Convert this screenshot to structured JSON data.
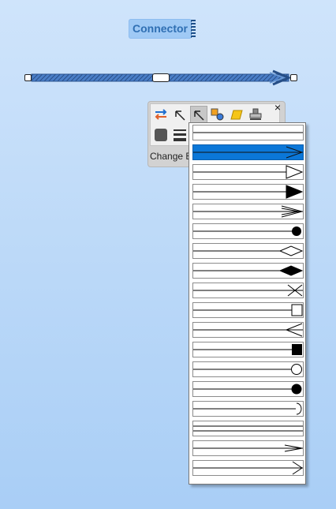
{
  "connector": {
    "label": "Connector"
  },
  "toolbar": {
    "caption": "Change End",
    "buttons": [
      {
        "icon": "swap-direction-icon"
      },
      {
        "icon": "pointer-arrow-icon"
      },
      {
        "icon": "end-style-arrow-icon",
        "active": true
      },
      {
        "icon": "shapes-icon"
      },
      {
        "icon": "fill-color-icon"
      },
      {
        "icon": "stamp-icon"
      },
      {
        "icon": "line-color-icon"
      },
      {
        "icon": "line-weight-icon"
      }
    ],
    "close_symbol": "×"
  },
  "end_styles": {
    "selected_index": 1,
    "items": [
      "none",
      "open-arrow",
      "open-triangle",
      "filled-triangle",
      "double-open-arrow",
      "filled-circle",
      "open-diamond",
      "filled-diamond",
      "crows-foot",
      "open-square",
      "reverse-open-arrow",
      "filled-square",
      "open-circle",
      "filled-circle-large",
      "half-circle",
      "double-line",
      "thin-arrow",
      "long-arrow"
    ]
  },
  "colors": {
    "accent": "#0b77d8",
    "label_text": "#2f6fb3",
    "background_top": "#cfe4fb",
    "background_bottom": "#a9cef6"
  }
}
